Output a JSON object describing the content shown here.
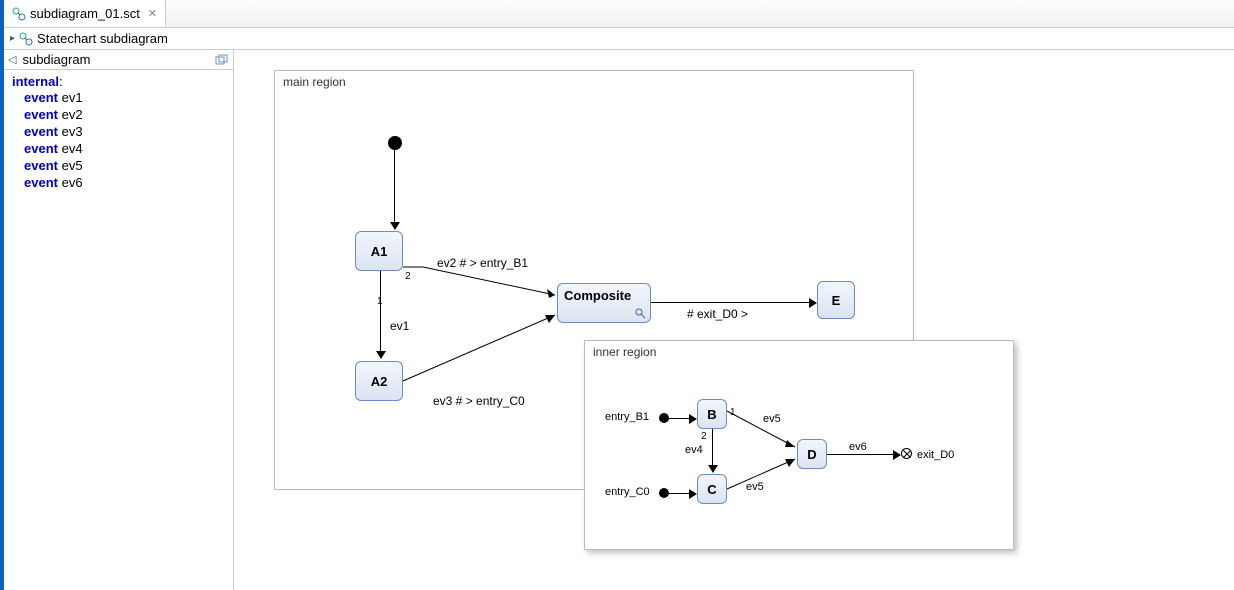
{
  "tab": {
    "title": "subdiagram_01.sct",
    "close_glyph": "✕"
  },
  "breadcrumb": {
    "label": "Statechart subdiagram"
  },
  "sidebar": {
    "header_left_glyph": "◁",
    "header_title": "subdiagram",
    "internal_kw": "internal",
    "colon": ":",
    "event_kw": "event",
    "events": [
      "ev1",
      "ev2",
      "ev3",
      "ev4",
      "ev5",
      "ev6"
    ]
  },
  "main_region": {
    "label": "main region",
    "states": {
      "A1": "A1",
      "A2": "A2",
      "Composite": "Composite",
      "E": "E"
    },
    "port_numbers": {
      "a1_out2": "2",
      "a1_out1": "1"
    },
    "transitions": {
      "a1_to_a2": "ev1",
      "a1_to_comp": "ev2 # > entry_B1",
      "a2_to_comp": "ev3 # > entry_C0",
      "comp_to_e": "# exit_D0 >"
    }
  },
  "inner_region": {
    "label": "inner region",
    "entries": {
      "entry_B1": "entry_B1",
      "entry_C0": "entry_C0"
    },
    "states": {
      "B": "B",
      "C": "C",
      "D": "D"
    },
    "exit": "exit_D0",
    "port_numbers": {
      "b_out1": "1",
      "b_out2": "2"
    },
    "transitions": {
      "b_to_c": "ev4",
      "b_to_d": "ev5",
      "c_to_d": "ev5",
      "d_to_exit": "ev6"
    }
  }
}
